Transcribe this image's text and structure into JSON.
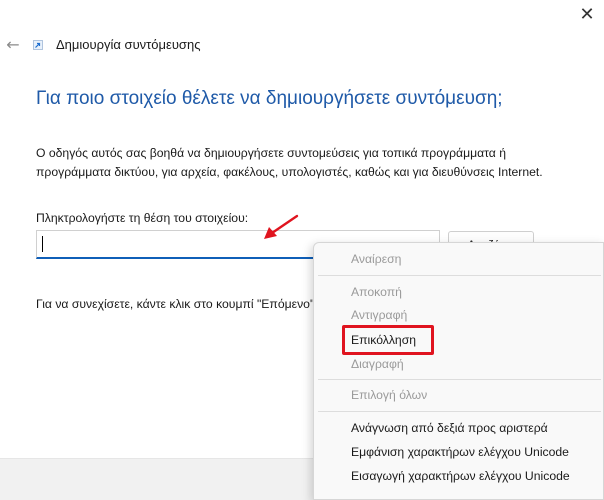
{
  "window": {
    "close_glyph": "✕",
    "back_glyph": "←",
    "title": "Δημιουργία συντόμευσης"
  },
  "wizard": {
    "heading": "Για ποιο στοιχείο θέλετε να δημιουργήσετε συντόμευση;",
    "description": "Ο οδηγός αυτός σας βοηθά να δημιουργήσετε συντομεύσεις για τοπικά προγράμματα ή προγράμματα δικτύου, για αρχεία, φακέλους, υπολογιστές, καθώς και για διευθύνσεις Internet.",
    "location_label": "Πληκτρολογήστε τη θέση του στοιχείου:",
    "location_value": "",
    "browse_label": "Αναζήτ...",
    "continue_text": "Για να συνεχίσετε, κάντε κλικ στο κουμπί \"Επόμενο\"."
  },
  "context_menu": {
    "undo": "Αναίρεση",
    "cut": "Αποκοπή",
    "copy": "Αντιγραφή",
    "paste": "Επικόλληση",
    "delete": "Διαγραφή",
    "select_all": "Επιλογή όλων",
    "rtl_reading": "Ανάγνωση από δεξιά προς αριστερά",
    "show_unicode": "Εμφάνιση χαρακτήρων ελέγχου Unicode",
    "insert_unicode": "Εισαγωγή χαρακτήρων ελέγχου Unicode"
  },
  "colors": {
    "heading": "#1f5aa8",
    "input_focus": "#0f5fb8",
    "annotation_red": "#e0141f"
  },
  "icons": {
    "close": "close-icon",
    "back": "back-arrow-icon",
    "wizard": "shortcut-wizard-icon",
    "annotation": "red-arrow-annotation"
  }
}
